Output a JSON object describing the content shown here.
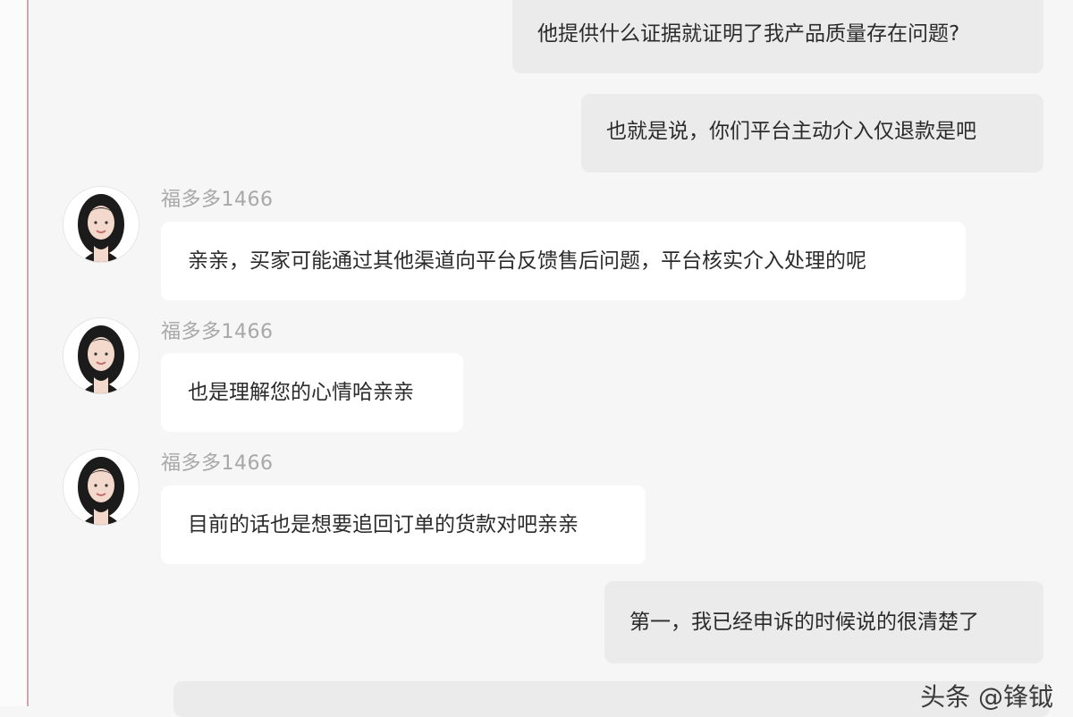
{
  "messages": [
    {
      "type": "outgoing",
      "text": "他提供什么证据就证明了我产品质量存在问题?"
    },
    {
      "type": "outgoing",
      "text": "也就是说，你们平台主动介入仅退款是吧"
    },
    {
      "type": "incoming",
      "sender": "福多多1466",
      "text": "亲亲，买家可能通过其他渠道向平台反馈售后问题，平台核实介入处理的呢"
    },
    {
      "type": "incoming",
      "sender": "福多多1466",
      "text": "也是理解您的心情哈亲亲"
    },
    {
      "type": "incoming",
      "sender": "福多多1466",
      "text": "目前的话也是想要追回订单的货款对吧亲亲"
    },
    {
      "type": "outgoing",
      "text": "第一，我已经申诉的时候说的很清楚了"
    }
  ],
  "watermark": "头条 @锋钺",
  "colors": {
    "page_bg": "#f6f6f6",
    "outgoing_bubble": "#ebebeb",
    "incoming_bubble": "#ffffff",
    "sender_text": "#a8a8a8",
    "left_border": "#cfa6ad"
  },
  "icons": {
    "avatar": "agent-avatar-icon"
  }
}
